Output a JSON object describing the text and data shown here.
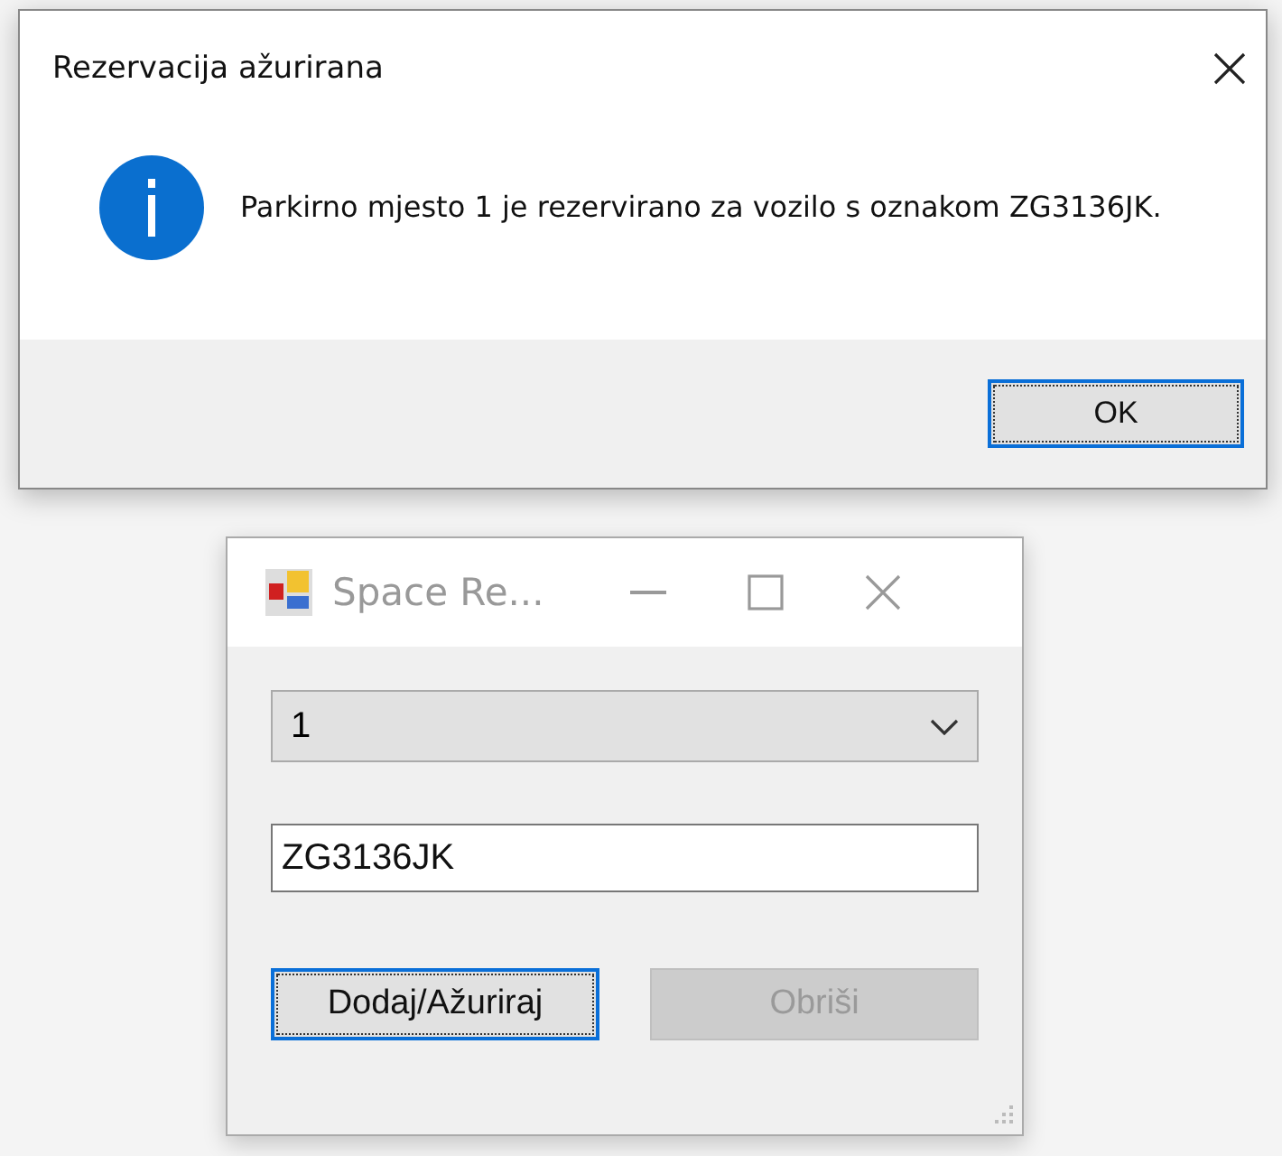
{
  "dialog": {
    "title": "Rezervacija ažurirana",
    "message": "Parkirno mjesto 1 je rezervirano za vozilo s oznakom ZG3136JK.",
    "buttons": [
      {
        "label": "OK",
        "focused": true,
        "disabled": false
      }
    ]
  },
  "form_window": {
    "title": "Space Re...",
    "active": false,
    "dropdown": {
      "value": "1"
    },
    "text_field": {
      "value": "ZG3136JK"
    },
    "buttons": [
      {
        "label": "Dodaj/Ažuriraj",
        "focused": true,
        "disabled": false
      },
      {
        "label": "Obriši",
        "focused": false,
        "disabled": true
      }
    ]
  }
}
